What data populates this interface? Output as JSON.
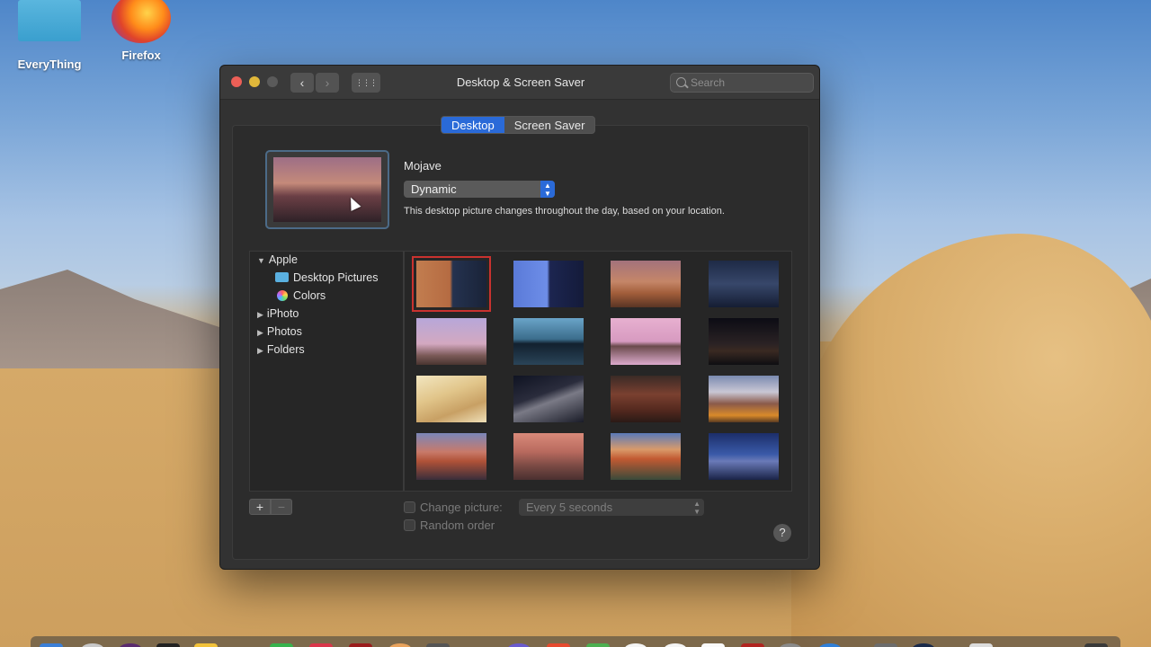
{
  "desktop": {
    "icons": [
      {
        "label": "EveryThing",
        "icon": "folder-icon"
      },
      {
        "label": "Firefox",
        "icon": "firefox-icon"
      }
    ]
  },
  "window": {
    "title": "Desktop & Screen Saver",
    "search_placeholder": "Search",
    "traffic_lights": {
      "close": "#ec5f57",
      "minimize": "#e0b73a",
      "zoom": "#5a5a5a"
    },
    "nav": {
      "back": "‹",
      "forward": "›",
      "grid": "⋮⋮⋮"
    }
  },
  "tabs": [
    {
      "label": "Desktop",
      "active": true
    },
    {
      "label": "Screen Saver",
      "active": false
    }
  ],
  "wallpaper": {
    "name": "Mojave",
    "mode": "Dynamic",
    "description": "This desktop picture changes throughout the day, based on your location."
  },
  "sidebar": {
    "items": [
      {
        "label": "Apple",
        "expanded": true
      },
      {
        "label": "Desktop Pictures",
        "icon": "folder-icon"
      },
      {
        "label": "Colors",
        "icon": "color-wheel-icon"
      },
      {
        "label": "iPhoto",
        "expanded": false
      },
      {
        "label": "Photos",
        "expanded": false
      },
      {
        "label": "Folders",
        "expanded": false
      }
    ]
  },
  "grid": {
    "selected_index": 0
  },
  "footer": {
    "add": "+",
    "remove": "−",
    "change_picture_label": "Change picture:",
    "interval": "Every 5 seconds",
    "random_order_label": "Random order",
    "help": "?"
  },
  "colors": {
    "accent": "#2a6ad8",
    "selection_border": "#c9322f"
  }
}
